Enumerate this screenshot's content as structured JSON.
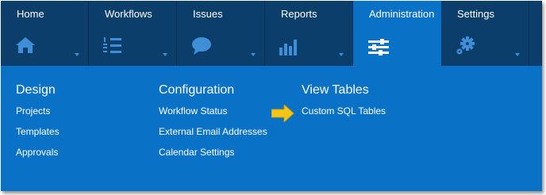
{
  "nav": {
    "tabs": [
      {
        "label": "Home",
        "icon": "home-icon"
      },
      {
        "label": "Workflows",
        "icon": "workflow-list-icon"
      },
      {
        "label": "Issues",
        "icon": "speech-bubble-icon"
      },
      {
        "label": "Reports",
        "icon": "bar-chart-icon"
      },
      {
        "label": "Administration",
        "icon": "sliders-icon",
        "active": true
      },
      {
        "label": "Settings",
        "icon": "gears-icon"
      }
    ]
  },
  "menu": {
    "design": {
      "heading": "Design",
      "links": [
        "Projects",
        "Templates",
        "Approvals"
      ]
    },
    "configuration": {
      "heading": "Configuration",
      "links": [
        "Workflow Status",
        "External Email Addresses",
        "Calendar Settings"
      ]
    },
    "view_tables": {
      "heading": "View Tables",
      "links": [
        "Custom SQL Tables"
      ]
    }
  },
  "colors": {
    "nav_background": "#0b3e6a",
    "active_tab": "#0a72c6",
    "menu_background": "#0a72c6",
    "icon_muted": "#3f8ed8",
    "pointer_arrow": "#f5c518"
  }
}
